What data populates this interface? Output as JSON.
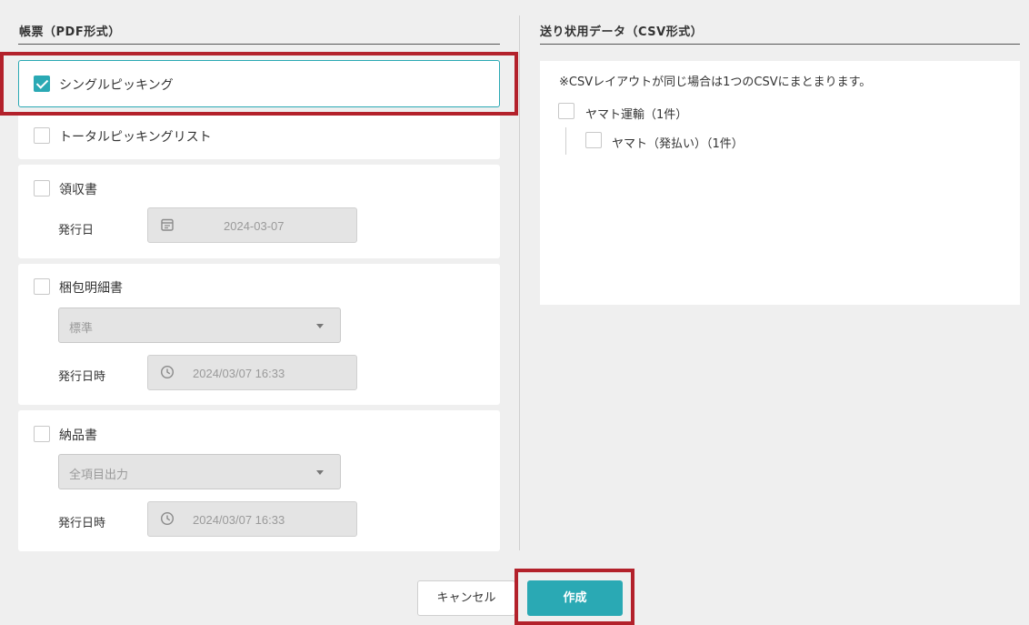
{
  "pdf_section": {
    "title": "帳票（PDF形式）",
    "items": [
      {
        "label": "シングルピッキング",
        "checked": true
      },
      {
        "label": "トータルピッキングリスト",
        "checked": false
      },
      {
        "label": "領収書",
        "checked": false,
        "date_label": "発行日",
        "date_value": "2024-03-07",
        "icon": "calendar-icon"
      },
      {
        "label": "梱包明細書",
        "checked": false,
        "select_value": "標準",
        "date_label": "発行日時",
        "date_value": "2024/03/07 16:33",
        "icon": "clock-icon"
      },
      {
        "label": "納品書",
        "checked": false,
        "select_value": "全項目出力",
        "date_label": "発行日時",
        "date_value": "2024/03/07 16:33",
        "icon": "clock-icon"
      }
    ]
  },
  "csv_section": {
    "title": "送り状用データ（CSV形式）",
    "note": "※CSVレイアウトが同じ場合は1つのCSVにまとまります。",
    "tree": [
      {
        "label": "ヤマト運輸（1件）",
        "checked": false,
        "children": [
          {
            "label": "ヤマト（発払い）（1件）",
            "checked": false
          }
        ]
      }
    ]
  },
  "buttons": {
    "cancel": "キャンセル",
    "create": "作成"
  },
  "colors": {
    "accent": "#2aa9b4",
    "highlight": "#b3212b",
    "background": "#efefef"
  }
}
